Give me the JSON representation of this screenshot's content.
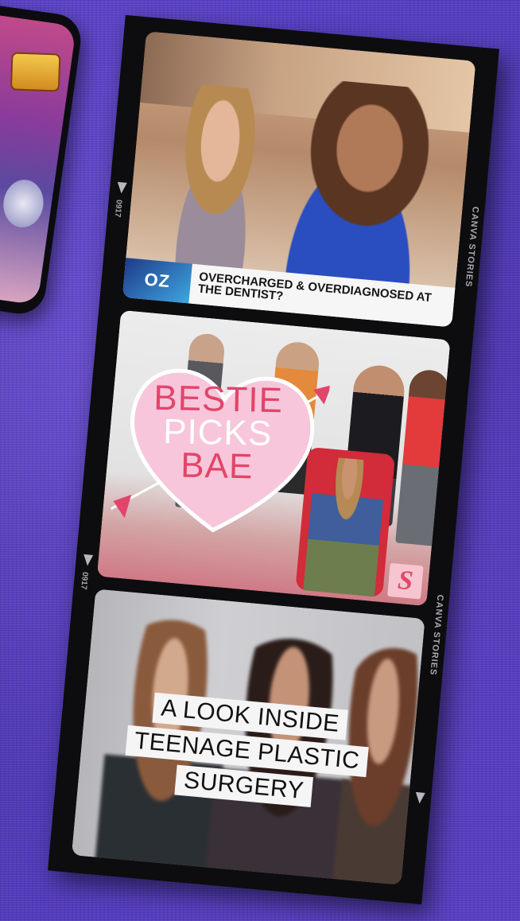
{
  "strip": {
    "frame_number": "0917",
    "edge_brand": "CANVA STORIES"
  },
  "frames": [
    {
      "logo": "OZ",
      "headline": "OVERCHARGED & OVERDIAGNOSED AT THE DENTIST?"
    },
    {
      "heart_lines": [
        "BESTIE",
        "PICKS",
        "BAE"
      ],
      "badge": "S"
    },
    {
      "caption_lines": [
        "A LOOK INSIDE",
        "TEENAGE PLASTIC",
        "SURGERY"
      ]
    }
  ],
  "colors": {
    "background": "#5440c0",
    "strip": "#0d0d0f",
    "heart": "#f7c6da",
    "heart_accent": "#e2456a"
  }
}
